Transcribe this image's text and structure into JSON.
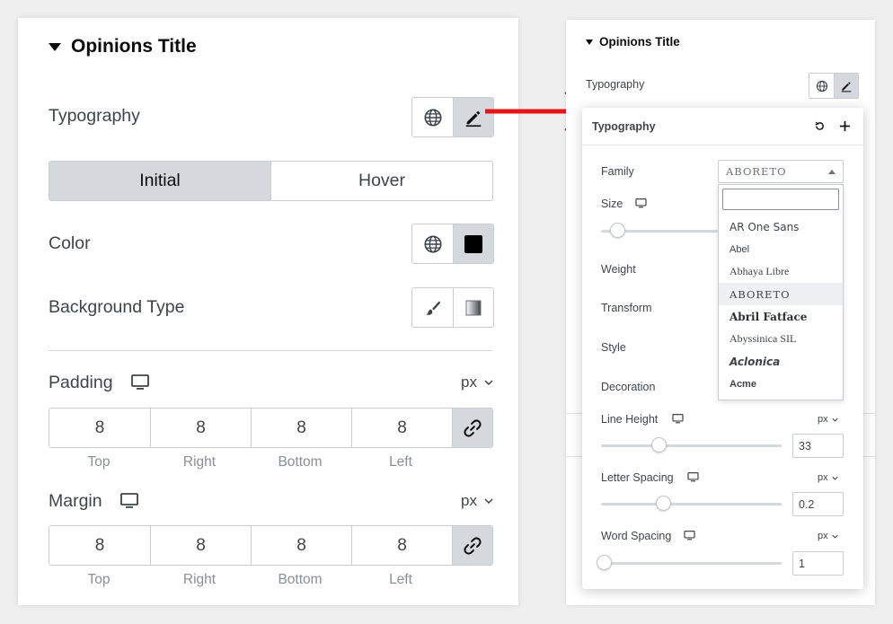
{
  "left": {
    "section_title": "Opinions Title",
    "typography_label": "Typography",
    "tabs": [
      {
        "label": "Initial",
        "active": true
      },
      {
        "label": "Hover",
        "active": false
      }
    ],
    "color_label": "Color",
    "color_swatch": "#000000",
    "background_type_label": "Background Type",
    "padding": {
      "label": "Padding",
      "unit": "px",
      "values": [
        "8",
        "8",
        "8",
        "8"
      ],
      "sides": [
        "Top",
        "Right",
        "Bottom",
        "Left"
      ]
    },
    "margin": {
      "label": "Margin",
      "unit": "px",
      "values": [
        "8",
        "8",
        "8",
        "8"
      ],
      "sides": [
        "Top",
        "Right",
        "Bottom",
        "Left"
      ]
    }
  },
  "right": {
    "section_title": "Opinions Title",
    "typography_label": "Typography",
    "popover": {
      "title": "Typography",
      "family_label": "Family",
      "family_value": "ABORETO",
      "size_label": "Size",
      "weight_label": "Weight",
      "transform_label": "Transform",
      "style_label": "Style",
      "decoration_label": "Decoration",
      "font_options": [
        "AR One Sans",
        "Abel",
        "Abhaya Libre",
        "ABORETO",
        "Abril Fatface",
        "Abyssinica SIL",
        "Aclonica",
        "Acme"
      ],
      "selected_option": "ABORETO",
      "line_height": {
        "label": "Line Height",
        "unit": "px",
        "value": "33"
      },
      "letter_spacing": {
        "label": "Letter Spacing",
        "unit": "px",
        "value": "0.2"
      },
      "word_spacing": {
        "label": "Word Spacing",
        "unit": "px",
        "value": "1"
      }
    }
  },
  "colors": {
    "arrow": "#e8141a",
    "active_bg": "#d5d8dc",
    "text": "#3f444b"
  }
}
